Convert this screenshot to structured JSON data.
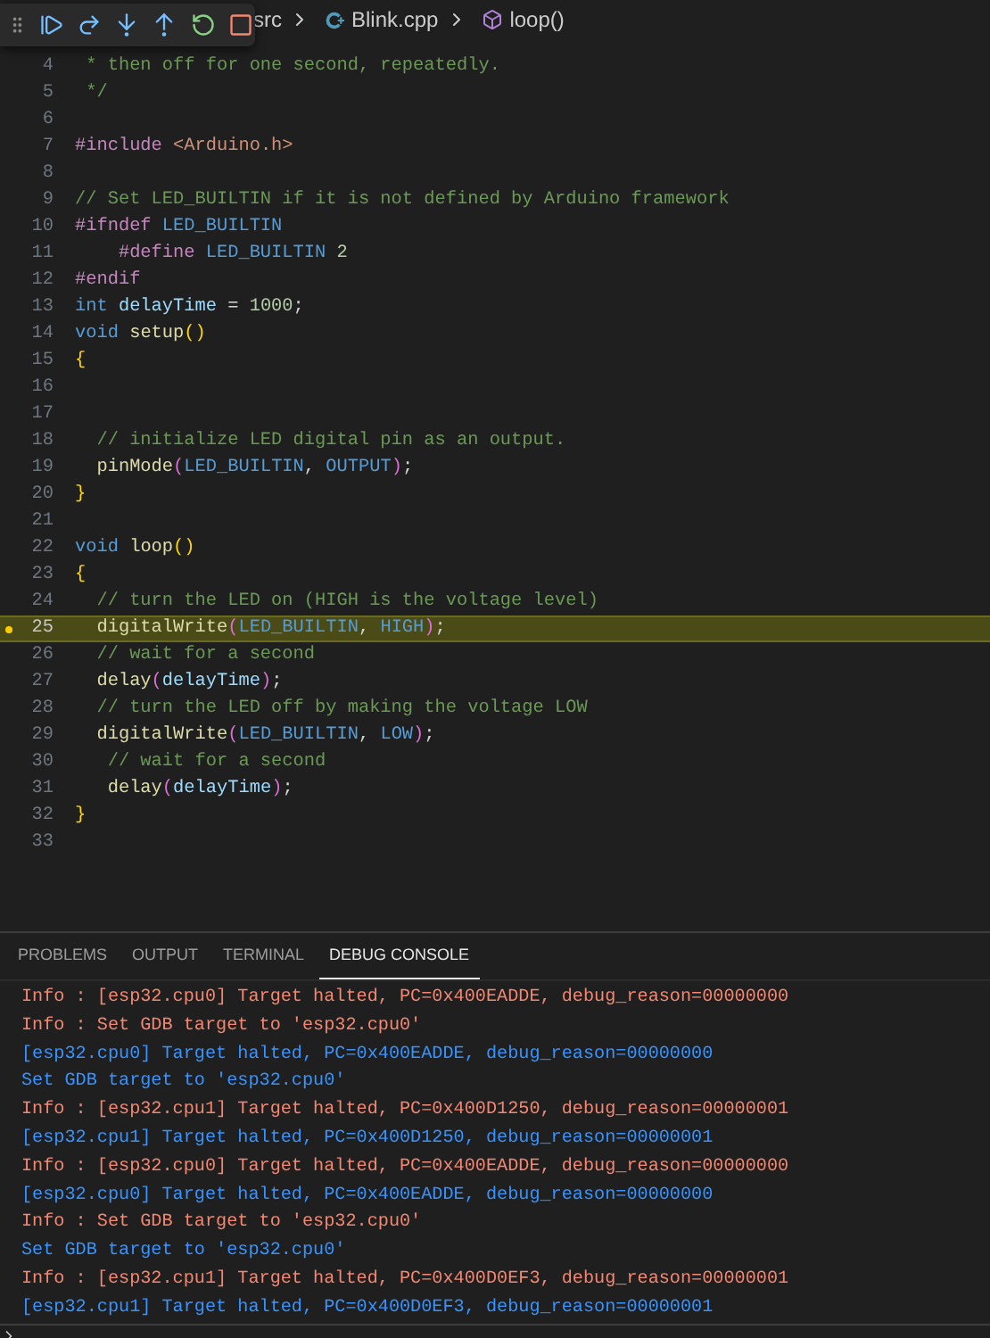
{
  "breadcrumb": {
    "items": [
      {
        "kind": "folder",
        "label": "src"
      },
      {
        "kind": "file",
        "label": "Blink.cpp"
      },
      {
        "kind": "symbol",
        "label": "loop()"
      }
    ]
  },
  "debug_toolbar": {
    "buttons": [
      {
        "kind": "continue"
      },
      {
        "kind": "step_over"
      },
      {
        "kind": "step_into"
      },
      {
        "kind": "step_out"
      },
      {
        "kind": "restart"
      },
      {
        "kind": "stop"
      }
    ]
  },
  "editor": {
    "lines": [
      {
        "number": "4",
        "current": false,
        "tokens": [
          {
            "kind": "comment",
            "text": " * then off for one second, repeatedly."
          }
        ]
      },
      {
        "number": "5",
        "current": false,
        "tokens": [
          {
            "kind": "comment",
            "text": " */"
          }
        ]
      },
      {
        "number": "6",
        "current": false
      },
      {
        "number": "7",
        "current": false,
        "tokens": [
          {
            "kind": "directive",
            "text": "#include"
          },
          {
            "kind": "string",
            "text": " <Arduino.h>"
          }
        ]
      },
      {
        "number": "8",
        "current": false
      },
      {
        "number": "9",
        "current": false,
        "tokens": [
          {
            "kind": "comment",
            "text": "// Set LED_BUILTIN if it is not defined by Arduino framework"
          }
        ]
      },
      {
        "number": "10",
        "current": false,
        "tokens": [
          {
            "kind": "directive",
            "text": "#ifndef"
          },
          {
            "kind": "macro",
            "text": " LED_BUILTIN"
          }
        ]
      },
      {
        "number": "11",
        "current": false,
        "tokens": [
          {
            "kind": "directive",
            "text": "    #define"
          },
          {
            "kind": "macro",
            "text": " LED_BUILTIN"
          },
          {
            "kind": "number",
            "text": " 2"
          }
        ]
      },
      {
        "number": "12",
        "current": false,
        "tokens": [
          {
            "kind": "directive",
            "text": "#endif"
          }
        ]
      },
      {
        "number": "13",
        "current": false,
        "tokens": [
          {
            "kind": "keyword",
            "text": "int"
          },
          {
            "kind": "variable",
            "text": " delayTime"
          },
          {
            "kind": "plain",
            "text": " = "
          },
          {
            "kind": "number",
            "text": "1000"
          },
          {
            "kind": "plain",
            "text": ";"
          }
        ]
      },
      {
        "number": "14",
        "current": false,
        "tokens": [
          {
            "kind": "keyword",
            "text": "void"
          },
          {
            "kind": "function",
            "text": " setup"
          },
          {
            "kind": "bracket",
            "text": "()"
          }
        ]
      },
      {
        "number": "15",
        "current": false,
        "tokens": [
          {
            "kind": "bracket",
            "text": "{"
          }
        ]
      },
      {
        "number": "16",
        "current": false
      },
      {
        "number": "17",
        "current": false
      },
      {
        "number": "18",
        "current": false,
        "tokens": [
          {
            "kind": "comment",
            "text": "  // initialize LED digital pin as an output."
          }
        ]
      },
      {
        "number": "19",
        "current": false,
        "tokens": [
          {
            "kind": "function",
            "text": "  pinMode"
          },
          {
            "kind": "paren",
            "text": "("
          },
          {
            "kind": "macro",
            "text": "LED_BUILTIN"
          },
          {
            "kind": "plain",
            "text": ", "
          },
          {
            "kind": "macro",
            "text": "OUTPUT"
          },
          {
            "kind": "paren",
            "text": ")"
          },
          {
            "kind": "plain",
            "text": ";"
          }
        ]
      },
      {
        "number": "20",
        "current": false,
        "tokens": [
          {
            "kind": "bracket",
            "text": "}"
          }
        ]
      },
      {
        "number": "21",
        "current": false
      },
      {
        "number": "22",
        "current": false,
        "tokens": [
          {
            "kind": "keyword",
            "text": "void"
          },
          {
            "kind": "function",
            "text": " loop"
          },
          {
            "kind": "bracket",
            "text": "()"
          }
        ]
      },
      {
        "number": "23",
        "current": false,
        "tokens": [
          {
            "kind": "bracket",
            "text": "{"
          }
        ]
      },
      {
        "number": "24",
        "current": false,
        "tokens": [
          {
            "kind": "comment",
            "text": "  // turn the LED on (HIGH is the voltage level)"
          }
        ]
      },
      {
        "number": "25",
        "current": true,
        "tokens": [
          {
            "kind": "function",
            "text": "  digitalWrite"
          },
          {
            "kind": "paren",
            "text": "("
          },
          {
            "kind": "macro",
            "text": "LED_BUILTIN"
          },
          {
            "kind": "plain",
            "text": ", "
          },
          {
            "kind": "macro",
            "text": "HIGH"
          },
          {
            "kind": "paren",
            "text": ")"
          },
          {
            "kind": "plain",
            "text": ";"
          }
        ]
      },
      {
        "number": "26",
        "current": false,
        "tokens": [
          {
            "kind": "comment",
            "text": "  // wait for a second"
          }
        ]
      },
      {
        "number": "27",
        "current": false,
        "tokens": [
          {
            "kind": "function",
            "text": "  delay"
          },
          {
            "kind": "paren",
            "text": "("
          },
          {
            "kind": "variable",
            "text": "delayTime"
          },
          {
            "kind": "paren",
            "text": ")"
          },
          {
            "kind": "plain",
            "text": ";"
          }
        ]
      },
      {
        "number": "28",
        "current": false,
        "tokens": [
          {
            "kind": "comment",
            "text": "  // turn the LED off by making the voltage LOW"
          }
        ]
      },
      {
        "number": "29",
        "current": false,
        "tokens": [
          {
            "kind": "function",
            "text": "  digitalWrite"
          },
          {
            "kind": "paren",
            "text": "("
          },
          {
            "kind": "macro",
            "text": "LED_BUILTIN"
          },
          {
            "kind": "plain",
            "text": ", "
          },
          {
            "kind": "macro",
            "text": "LOW"
          },
          {
            "kind": "paren",
            "text": ")"
          },
          {
            "kind": "plain",
            "text": ";"
          }
        ]
      },
      {
        "number": "30",
        "current": false,
        "tokens": [
          {
            "kind": "comment",
            "text": "   // wait for a second"
          }
        ]
      },
      {
        "number": "31",
        "current": false,
        "tokens": [
          {
            "kind": "function",
            "text": "   delay"
          },
          {
            "kind": "paren",
            "text": "("
          },
          {
            "kind": "variable",
            "text": "delayTime"
          },
          {
            "kind": "paren",
            "text": ")"
          },
          {
            "kind": "plain",
            "text": ";"
          }
        ]
      },
      {
        "number": "32",
        "current": false,
        "tokens": [
          {
            "kind": "bracket",
            "text": "}"
          }
        ]
      },
      {
        "number": "33",
        "current": false
      }
    ]
  },
  "panel": {
    "tabs": [
      {
        "label": "PROBLEMS",
        "selected": false
      },
      {
        "label": "OUTPUT",
        "selected": false
      },
      {
        "label": "TERMINAL",
        "selected": false
      },
      {
        "label": "DEBUG CONSOLE",
        "selected": true
      }
    ],
    "console": [
      {
        "kind": "info",
        "text": "Info : [esp32.cpu0] Target halted, PC=0x400EADDE, debug_reason=00000000"
      },
      {
        "kind": "info",
        "text": "Info : Set GDB target to 'esp32.cpu0'"
      },
      {
        "kind": "gdb",
        "text": "[esp32.cpu0] Target halted, PC=0x400EADDE, debug_reason=00000000"
      },
      {
        "kind": "gdb",
        "text": "Set GDB target to 'esp32.cpu0'"
      },
      {
        "kind": "info",
        "text": "Info : [esp32.cpu1] Target halted, PC=0x400D1250, debug_reason=00000001"
      },
      {
        "kind": "gdb",
        "text": "[esp32.cpu1] Target halted, PC=0x400D1250, debug_reason=00000001"
      },
      {
        "kind": "info",
        "text": "Info : [esp32.cpu0] Target halted, PC=0x400EADDE, debug_reason=00000000"
      },
      {
        "kind": "gdb",
        "text": "[esp32.cpu0] Target halted, PC=0x400EADDE, debug_reason=00000000"
      },
      {
        "kind": "info",
        "text": "Info : Set GDB target to 'esp32.cpu0'"
      },
      {
        "kind": "gdb",
        "text": "Set GDB target to 'esp32.cpu0'"
      },
      {
        "kind": "info",
        "text": "Info : [esp32.cpu1] Target halted, PC=0x400D0EF3, debug_reason=00000001"
      },
      {
        "kind": "gdb",
        "text": "[esp32.cpu1] Target halted, PC=0x400D0EF3, debug_reason=00000001"
      }
    ]
  }
}
